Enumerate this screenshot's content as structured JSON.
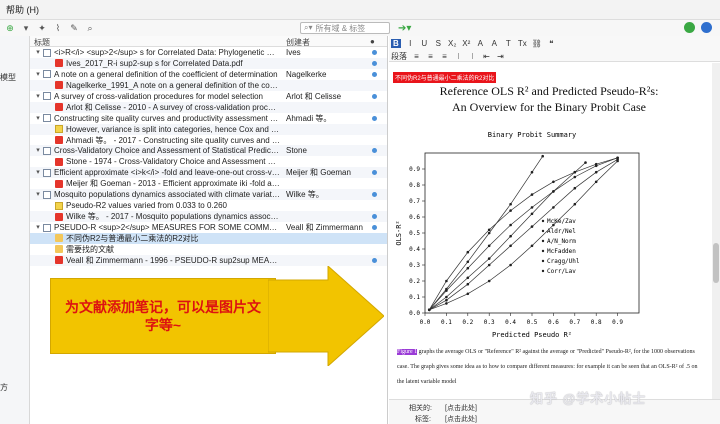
{
  "menu": {
    "help": "帮助 (H)"
  },
  "toolbar": {
    "search_placeholder": "所有域 & 标签",
    "new_item_icon": "plus-circle-icon",
    "attach_icon": "paperclip-icon",
    "sync_icon": "sync-icon"
  },
  "sidebar": {
    "item_model": "模型",
    "item_bottom": "方"
  },
  "list": {
    "col_title": "标题",
    "col_creator": "创建者",
    "rows": [
      {
        "kind": "doc",
        "indent": 0,
        "twisty": "▾",
        "title": "<i>R</i> <sup>2</sup> s for Correlated Data: Phylogenetic Models, LM...",
        "creator": "Ives",
        "dot": true
      },
      {
        "kind": "pdf",
        "indent": 1,
        "twisty": "",
        "title": "Ives_2017_R-i sup2-sup s for Correlated Data.pdf",
        "creator": "",
        "dot": true
      },
      {
        "kind": "doc",
        "indent": 0,
        "twisty": "▾",
        "title": "A note on a general definition of the coefficient of determination",
        "creator": "Nagelkerke",
        "dot": true
      },
      {
        "kind": "pdf",
        "indent": 1,
        "twisty": "",
        "title": "Nagelkerke_1991_A note on a general definition of the coefficient of det...",
        "creator": "",
        "dot": false
      },
      {
        "kind": "doc",
        "indent": 0,
        "twisty": "▾",
        "title": "A survey of cross-validation procedures for model selection",
        "creator": "Arlot 和 Celisse",
        "dot": true
      },
      {
        "kind": "pdf",
        "indent": 1,
        "twisty": "",
        "title": "Arlot 和 Celisse - 2010 - A survey of cross-validation procedures for mod...",
        "creator": "",
        "dot": false
      },
      {
        "kind": "doc",
        "indent": 0,
        "twisty": "▾",
        "title": "Constructing site quality curves and productivity assessment for uneven-a...",
        "creator": "Ahmadi 等。",
        "dot": true
      },
      {
        "kind": "note",
        "indent": 1,
        "twisty": "",
        "title": "However, variance is split into categories, hence Cox and Snell's, Nagelk...",
        "creator": "",
        "dot": false
      },
      {
        "kind": "pdf",
        "indent": 1,
        "twisty": "",
        "title": "Ahmadi 等。 - 2017 - Constructing site quality curves and productivity ...",
        "creator": "",
        "dot": false
      },
      {
        "kind": "doc",
        "indent": 0,
        "twisty": "▾",
        "title": "Cross-Validatory Choice and Assessment of Statistical Predictions",
        "creator": "Stone",
        "dot": true
      },
      {
        "kind": "pdf",
        "indent": 1,
        "twisty": "",
        "title": "Stone - 1974 - Cross-Validatory Choice and Assessment of Statisti.pdf",
        "creator": "",
        "dot": false
      },
      {
        "kind": "doc",
        "indent": 0,
        "twisty": "▾",
        "title": "Efficient approximate <i>k</i> -fold and leave-one-out cross-validation f...",
        "creator": "Meijer 和 Goeman",
        "dot": true
      },
      {
        "kind": "pdf",
        "indent": 1,
        "twisty": "",
        "title": "Meijer 和 Goeman - 2013 - Efficient approximate iki -fold and leave-one...",
        "creator": "",
        "dot": false
      },
      {
        "kind": "doc",
        "indent": 0,
        "twisty": "▾",
        "title": "Mosquito populations dynamics associated with climate variations",
        "creator": "Wilke 等。",
        "dot": true
      },
      {
        "kind": "note",
        "indent": 1,
        "twisty": "",
        "title": "Pseudo-R2 values varied from 0.033 to 0.260",
        "creator": "",
        "dot": false
      },
      {
        "kind": "pdf",
        "indent": 1,
        "twisty": "",
        "title": "Wilke 等。 - 2017 - Mosquito populations dynamics associated with clim...",
        "creator": "",
        "dot": true
      },
      {
        "kind": "doc",
        "indent": 0,
        "twisty": "▾",
        "title": "PSEUDO-R <sup>2</sup> MEASURES FOR SOME COMMON LIMITED DEP...",
        "creator": "Veall 和 Zimmermann",
        "dot": true
      },
      {
        "kind": "folder",
        "indent": 1,
        "twisty": "",
        "title": "不同伪R2与普通最小二乘法的R2对比",
        "creator": "",
        "dot": false,
        "selected": true
      },
      {
        "kind": "folder",
        "indent": 1,
        "twisty": "",
        "title": "需要找的文献",
        "creator": "",
        "dot": false
      },
      {
        "kind": "pdf",
        "indent": 1,
        "twisty": "",
        "title": "Veall 和 Zimmermann - 1996 - PSEUDO-R sup2sup MEASURES FOR SOM...",
        "creator": "",
        "dot": true
      }
    ]
  },
  "callout": {
    "text": "为文献添加笔记，可以是图片文\n字等~"
  },
  "editor": {
    "toolbar_row1": [
      "B",
      "I",
      "U",
      "S",
      "X₂",
      "X²",
      "A",
      "A",
      "T",
      "Tx",
      "⛓",
      "❝"
    ],
    "toolbar_row2": [
      "段落",
      "≡",
      "≡",
      "≡",
      "⁝",
      "⁝",
      "⇤",
      "⇥"
    ],
    "highlight_note": "不同伪R2与普通最小二乘法的R2对比",
    "paper_title_line1": "Reference OLS R² and Predicted Pseudo-R²s:",
    "paper_title_line2": "An Overview for the Binary Probit Case",
    "para_mark": "Figure 1",
    "para_text": " graphs the average OLS or \"Reference\" R² against the average or \"Predicted\" Pseudo-R², for the 1000 observations case. The graph gives some idea as to how to compare different measures: for example it can be seen that an OLS-R² of .5 on the latent variable model",
    "footer_related_label": "相关的:",
    "footer_related_value": "[点击此处]",
    "footer_tags_label": "标签:",
    "footer_tags_value": "[点击此处]"
  },
  "watermark": "知乎 @学术小帖士",
  "chart_data": {
    "type": "line",
    "title": "Binary Probit Summary",
    "xlabel": "Predicted Pseudo R²",
    "ylabel": "OLS-R²",
    "xlim": [
      0,
      1
    ],
    "ylim": [
      0,
      1
    ],
    "xticks": [
      "0.0",
      "0.1",
      "0.2",
      "0.3",
      "0.4",
      "0.5",
      "0.6",
      "0.7",
      "0.8",
      "0.9"
    ],
    "yticks": [
      "0.0",
      "0.1",
      "0.2",
      "0.3",
      "0.4",
      "0.5",
      "0.6",
      "0.7",
      "0.8",
      "0.9"
    ],
    "legend_position": "right",
    "series": [
      {
        "name": "McKe/Zav",
        "marker": "o",
        "points": [
          [
            0.02,
            0.02
          ],
          [
            0.1,
            0.15
          ],
          [
            0.2,
            0.32
          ],
          [
            0.3,
            0.5
          ],
          [
            0.4,
            0.68
          ],
          [
            0.5,
            0.88
          ],
          [
            0.55,
            0.98
          ]
        ]
      },
      {
        "name": "Aldr/Nel",
        "marker": "o",
        "points": [
          [
            0.02,
            0.02
          ],
          [
            0.1,
            0.1
          ],
          [
            0.2,
            0.22
          ],
          [
            0.3,
            0.34
          ],
          [
            0.4,
            0.48
          ],
          [
            0.5,
            0.62
          ],
          [
            0.6,
            0.76
          ],
          [
            0.7,
            0.88
          ],
          [
            0.75,
            0.94
          ]
        ]
      },
      {
        "name": "A/N_Norm",
        "marker": "o",
        "points": [
          [
            0.02,
            0.02
          ],
          [
            0.1,
            0.08
          ],
          [
            0.2,
            0.18
          ],
          [
            0.3,
            0.3
          ],
          [
            0.4,
            0.42
          ],
          [
            0.5,
            0.54
          ],
          [
            0.6,
            0.66
          ],
          [
            0.7,
            0.78
          ],
          [
            0.8,
            0.88
          ],
          [
            0.9,
            0.96
          ]
        ]
      },
      {
        "name": "McFadden",
        "marker": "o",
        "points": [
          [
            0.02,
            0.02
          ],
          [
            0.1,
            0.2
          ],
          [
            0.2,
            0.38
          ],
          [
            0.3,
            0.52
          ],
          [
            0.4,
            0.64
          ],
          [
            0.5,
            0.74
          ],
          [
            0.6,
            0.82
          ],
          [
            0.7,
            0.88
          ],
          [
            0.8,
            0.93
          ],
          [
            0.9,
            0.97
          ]
        ]
      },
      {
        "name": "Cragg/Uhl",
        "marker": "o",
        "points": [
          [
            0.02,
            0.02
          ],
          [
            0.1,
            0.14
          ],
          [
            0.2,
            0.28
          ],
          [
            0.3,
            0.42
          ],
          [
            0.4,
            0.55
          ],
          [
            0.5,
            0.66
          ],
          [
            0.6,
            0.76
          ],
          [
            0.7,
            0.85
          ],
          [
            0.8,
            0.92
          ],
          [
            0.9,
            0.97
          ]
        ]
      },
      {
        "name": "Corr/Lav",
        "marker": "o",
        "points": [
          [
            0.02,
            0.02
          ],
          [
            0.1,
            0.06
          ],
          [
            0.2,
            0.12
          ],
          [
            0.3,
            0.2
          ],
          [
            0.4,
            0.3
          ],
          [
            0.5,
            0.42
          ],
          [
            0.6,
            0.55
          ],
          [
            0.7,
            0.68
          ],
          [
            0.8,
            0.82
          ],
          [
            0.9,
            0.95
          ]
        ]
      }
    ]
  }
}
